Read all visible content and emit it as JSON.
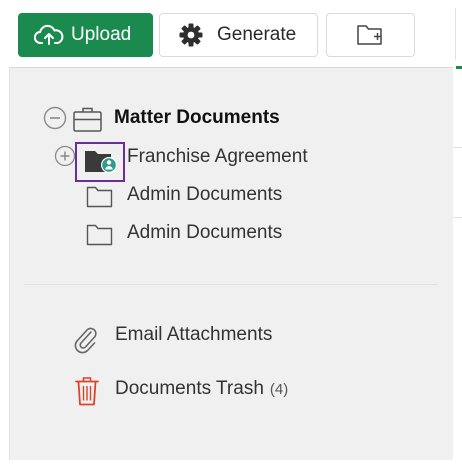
{
  "toolbar": {
    "upload_label": "Upload",
    "generate_label": "Generate",
    "upload_icon": "cloud-upload-icon",
    "generate_icon": "gear-icon",
    "new_folder_icon": "folder-plus-icon",
    "accent_color": "#1b8a4f"
  },
  "tree": {
    "root": {
      "label": "Matter Documents",
      "icon": "briefcase-icon",
      "toggle": "collapse-minus-icon"
    },
    "children": [
      {
        "label": "Franchise Agreement",
        "icon": "shared-folder-icon",
        "toggle": "expand-plus-icon",
        "selected": true
      },
      {
        "label": "Admin Documents",
        "icon": "folder-icon"
      },
      {
        "label": "Admin Documents",
        "icon": "folder-icon"
      }
    ]
  },
  "special": {
    "attachments": {
      "label": "Email Attachments",
      "icon": "paperclip-icon"
    },
    "trash": {
      "label": "Documents Trash",
      "count": "(4)",
      "icon": "trash-icon",
      "icon_color": "#d9442b"
    }
  }
}
